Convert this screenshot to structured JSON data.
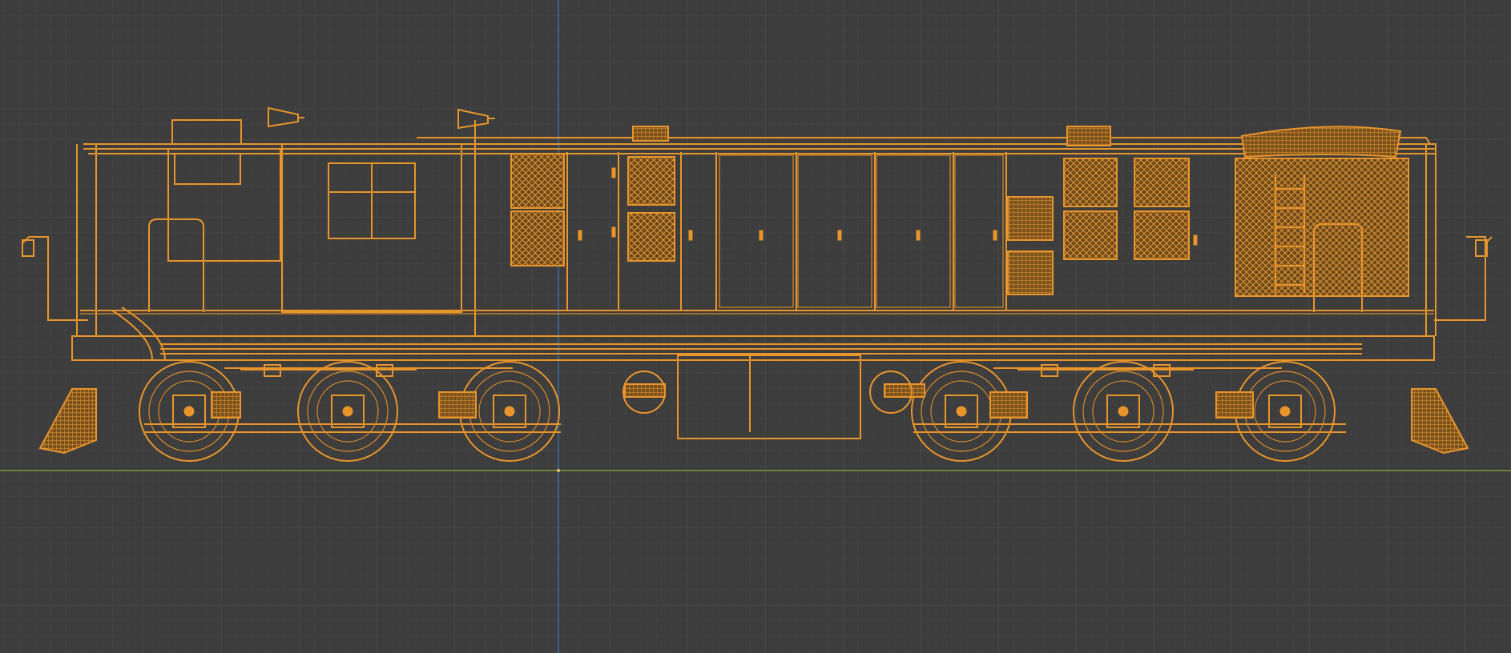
{
  "viewport": {
    "mode": "wireframe",
    "background": "#3d3d3d",
    "grid_color": "#464646",
    "wire_color": "#e8952b",
    "x_axis_color": "#7a9a3a",
    "z_axis_color": "#3b6fa0",
    "object": "diesel-locomotive"
  }
}
